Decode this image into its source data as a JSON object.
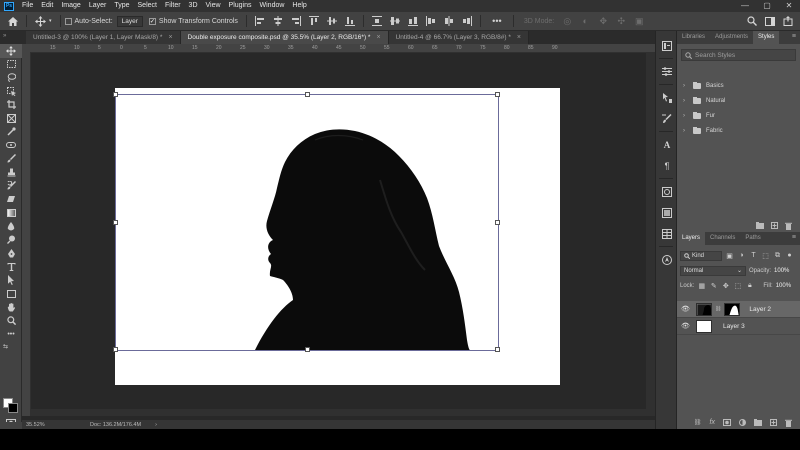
{
  "app": {
    "logo_text": "Ps"
  },
  "menu": [
    "File",
    "Edit",
    "Image",
    "Layer",
    "Type",
    "Select",
    "Filter",
    "3D",
    "View",
    "Plugins",
    "Window",
    "Help"
  ],
  "window_controls": {
    "minimize": "—",
    "maximize": "▢",
    "close": "✕"
  },
  "options_bar": {
    "auto_select_label": "Auto-Select:",
    "auto_select_checked": false,
    "auto_select_target": "Layer",
    "show_transform_label": "Show Transform Controls",
    "show_transform_checked": true,
    "more_label": "•••",
    "three_d_mode_label": "3D Mode:"
  },
  "tabs": [
    {
      "label": "Untitled-3 @ 100% (Layer 1, Layer Mask/8) *",
      "active": false
    },
    {
      "label": "Double exposure composite.psd @ 35.5% (Layer 2, RGB/16*) *",
      "active": true
    },
    {
      "label": "Untitled-4 @ 66.7% (Layer 3, RGB/8#) *",
      "active": false
    }
  ],
  "ruler_top_ticks": [
    "0",
    "15",
    "10",
    "5",
    "0",
    "5",
    "10",
    "15",
    "20",
    "25",
    "30",
    "35",
    "40",
    "45",
    "50",
    "55",
    "60",
    "65",
    "70",
    "75",
    "80",
    "85",
    "90"
  ],
  "status": {
    "zoom": "35.52%",
    "doc": "Doc: 136.2M/176.4M",
    "arrow": "›"
  },
  "styles_panel": {
    "tabs": [
      {
        "label": "Libraries",
        "active": false
      },
      {
        "label": "Adjustments",
        "active": false
      },
      {
        "label": "Styles",
        "active": true
      }
    ],
    "search_placeholder": "Search Styles",
    "groups": [
      "Basics",
      "Natural",
      "Fur",
      "Fabric"
    ]
  },
  "layers_panel": {
    "tabs": [
      {
        "label": "Layers",
        "active": true
      },
      {
        "label": "Channels",
        "active": false
      },
      {
        "label": "Paths",
        "active": false
      }
    ],
    "filter_kind": "Kind",
    "blend_mode": "Normal",
    "opacity_label": "Opacity:",
    "opacity_value": "100%",
    "lock_label": "Lock:",
    "fill_label": "Fill:",
    "fill_value": "100%",
    "layers": [
      {
        "name": "Layer 2",
        "visible": true,
        "selected": true,
        "has_mask": true
      },
      {
        "name": "Layer 3",
        "visible": true,
        "selected": false,
        "has_mask": false
      }
    ]
  },
  "colors": {
    "accent": "#31a8ff",
    "ui_dark": "#323232",
    "panel": "#535353",
    "canvas": "#ffffff"
  }
}
